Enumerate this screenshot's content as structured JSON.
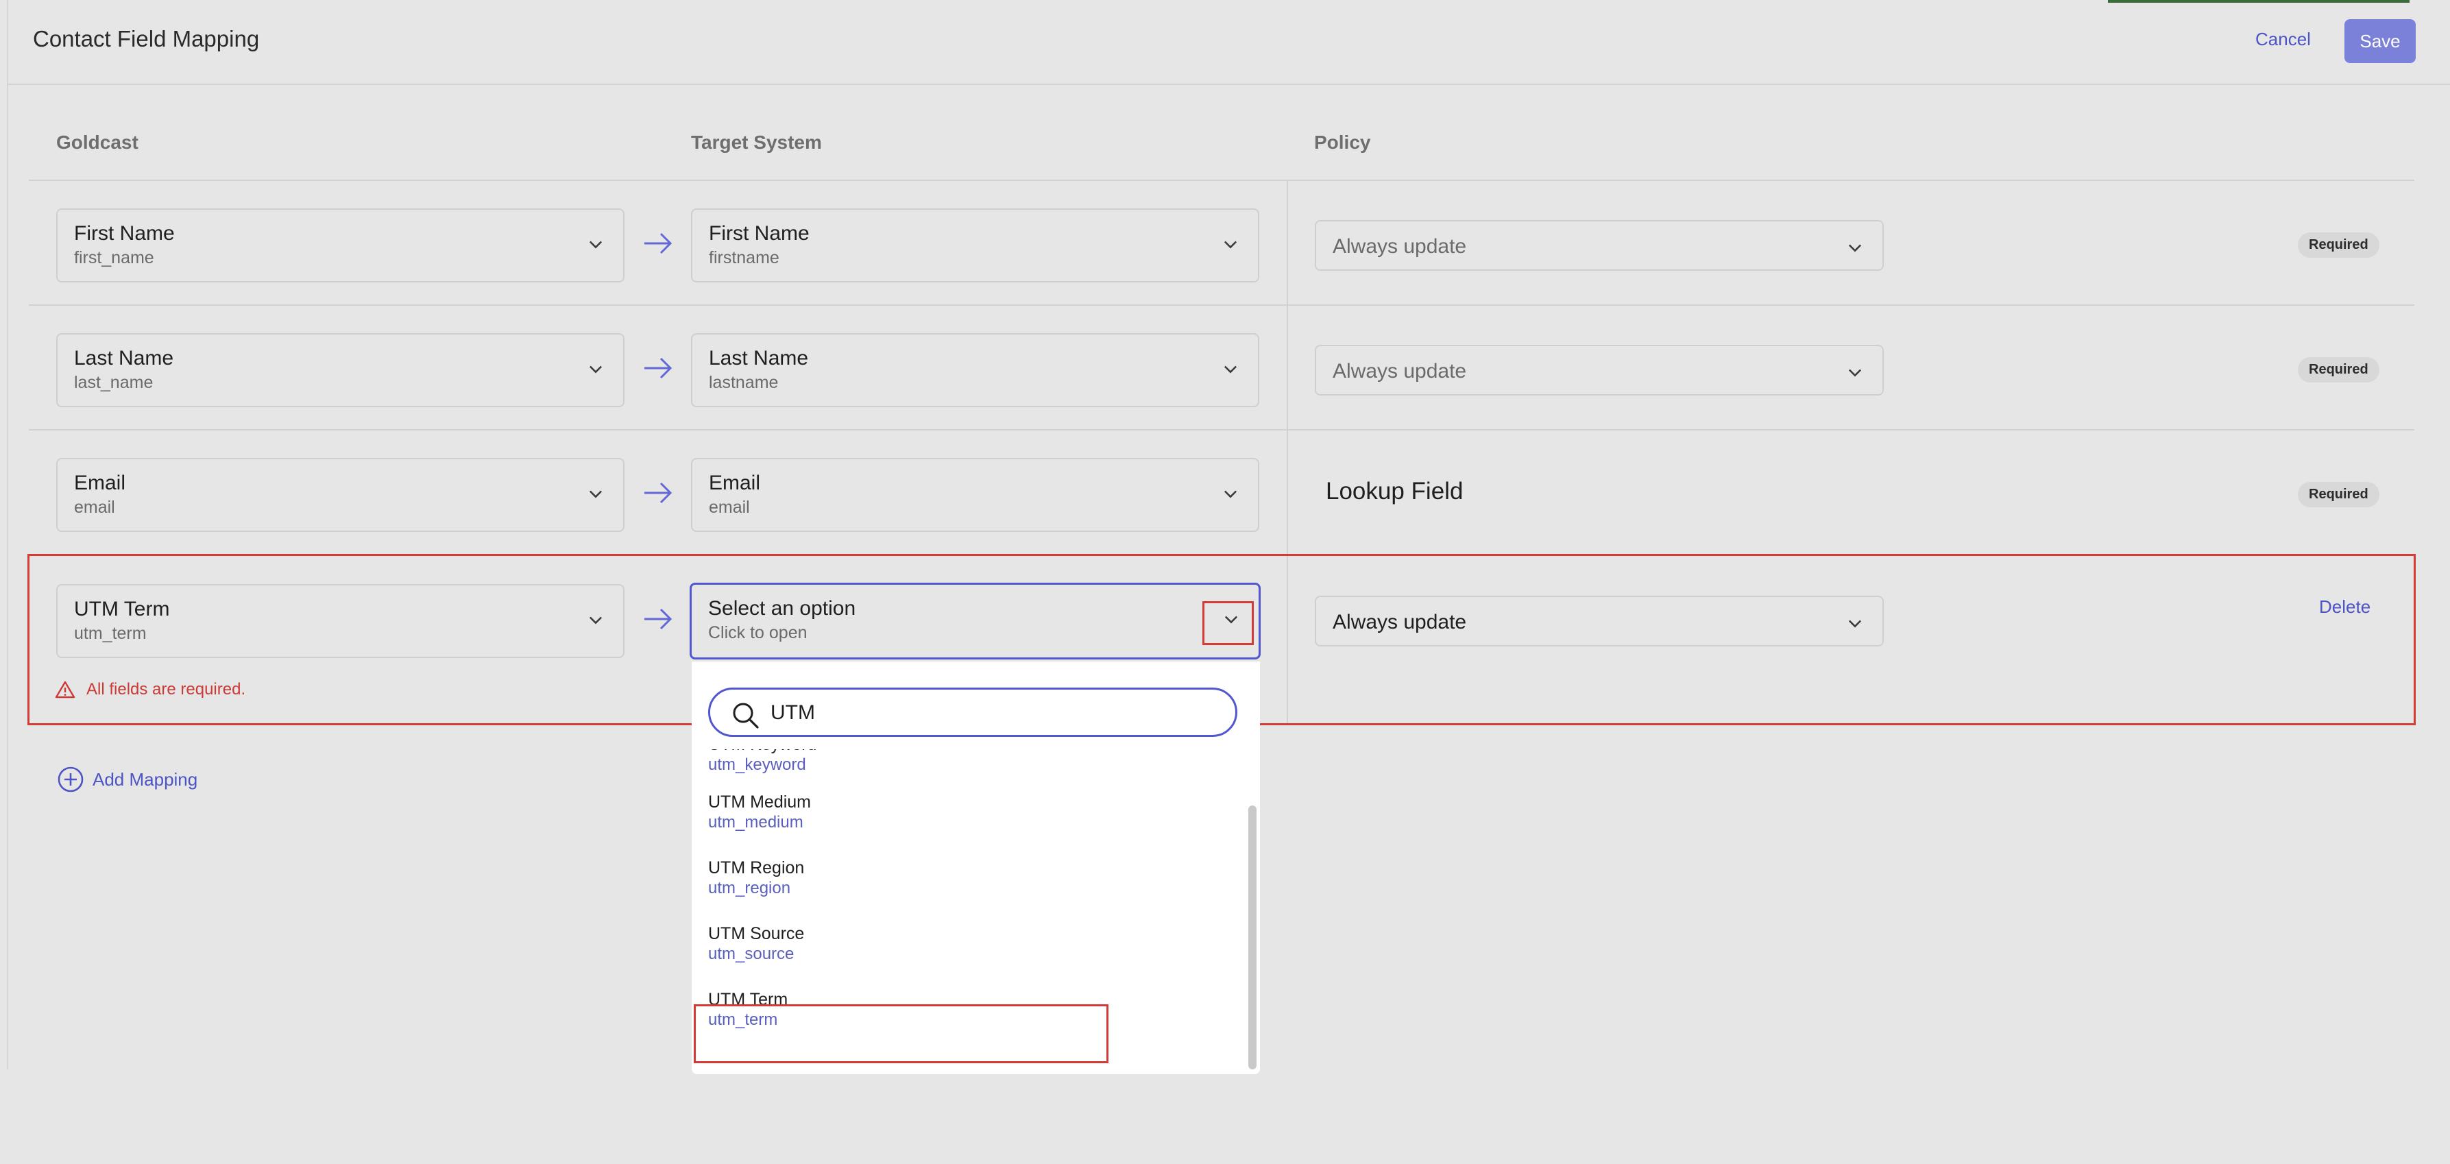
{
  "page": {
    "title": "Contact Field Mapping",
    "cancel_label": "Cancel",
    "save_label": "Save"
  },
  "columns": {
    "source": "Goldcast",
    "target": "Target System",
    "policy": "Policy"
  },
  "rows": [
    {
      "source": {
        "label": "First Name",
        "value": "first_name"
      },
      "target": {
        "label": "First Name",
        "value": "firstname"
      },
      "policy": "Always update",
      "badge": "Required"
    },
    {
      "source": {
        "label": "Last Name",
        "value": "last_name"
      },
      "target": {
        "label": "Last Name",
        "value": "lastname"
      },
      "policy": "Always update",
      "badge": "Required"
    },
    {
      "source": {
        "label": "Email",
        "value": "email"
      },
      "target": {
        "label": "Email",
        "value": "email"
      },
      "policy": "Lookup Field",
      "badge": "Required"
    },
    {
      "source": {
        "label": "UTM Term",
        "value": "utm_term"
      },
      "target": {
        "label": "Select an option",
        "value": "Click to open"
      },
      "policy": "Always update",
      "delete_label": "Delete",
      "error": "All fields are required."
    }
  ],
  "add_mapping_label": "Add Mapping",
  "dropdown": {
    "search_value": "UTM",
    "options": [
      {
        "label": "UTM Keyword",
        "value": "utm_keyword"
      },
      {
        "label": "UTM Medium",
        "value": "utm_medium"
      },
      {
        "label": "UTM Region",
        "value": "utm_region"
      },
      {
        "label": "UTM Source",
        "value": "utm_source"
      },
      {
        "label": "UTM Term",
        "value": "utm_term"
      }
    ]
  },
  "colors": {
    "accent": "#5157cf",
    "error": "#d33b36",
    "link": "#4d54c4",
    "save_button": "#7b80d8"
  },
  "icons": [
    "chevron-down-icon",
    "arrow-right-icon",
    "warning-icon",
    "plus-circle-icon",
    "search-icon"
  ]
}
